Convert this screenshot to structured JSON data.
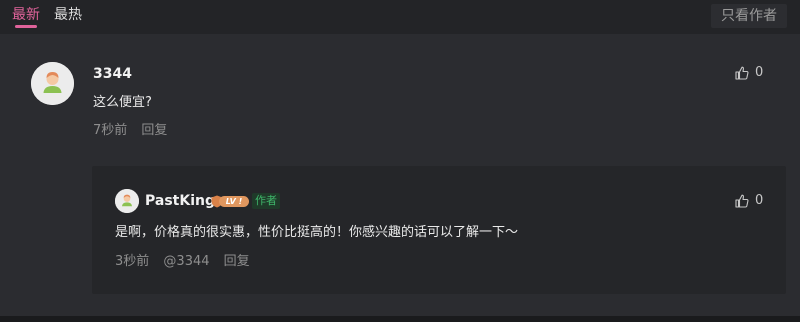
{
  "tabs": [
    {
      "label": "最新",
      "active": true
    },
    {
      "label": "最热",
      "active": false
    }
  ],
  "author_only_button": "只看作者",
  "colors": {
    "accent": "#e0639b",
    "author_tag": "#3fb56a",
    "level_badge": "#e0975f"
  },
  "comment": {
    "username": "3344",
    "avatar_icon": "default-avatar-icon",
    "text": "这么便宜?",
    "time": "7秒前",
    "reply_label": "回复",
    "likes": "0",
    "reply": {
      "username": "PastKing",
      "level_badge": "LV !",
      "author_tag": "作者",
      "avatar_icon": "default-avatar-icon",
      "text": "是啊，价格真的很实惠，性价比挺高的！你感兴趣的话可以了解一下～",
      "time": "3秒前",
      "mention": "@3344",
      "reply_label": "回复",
      "likes": "0"
    }
  }
}
